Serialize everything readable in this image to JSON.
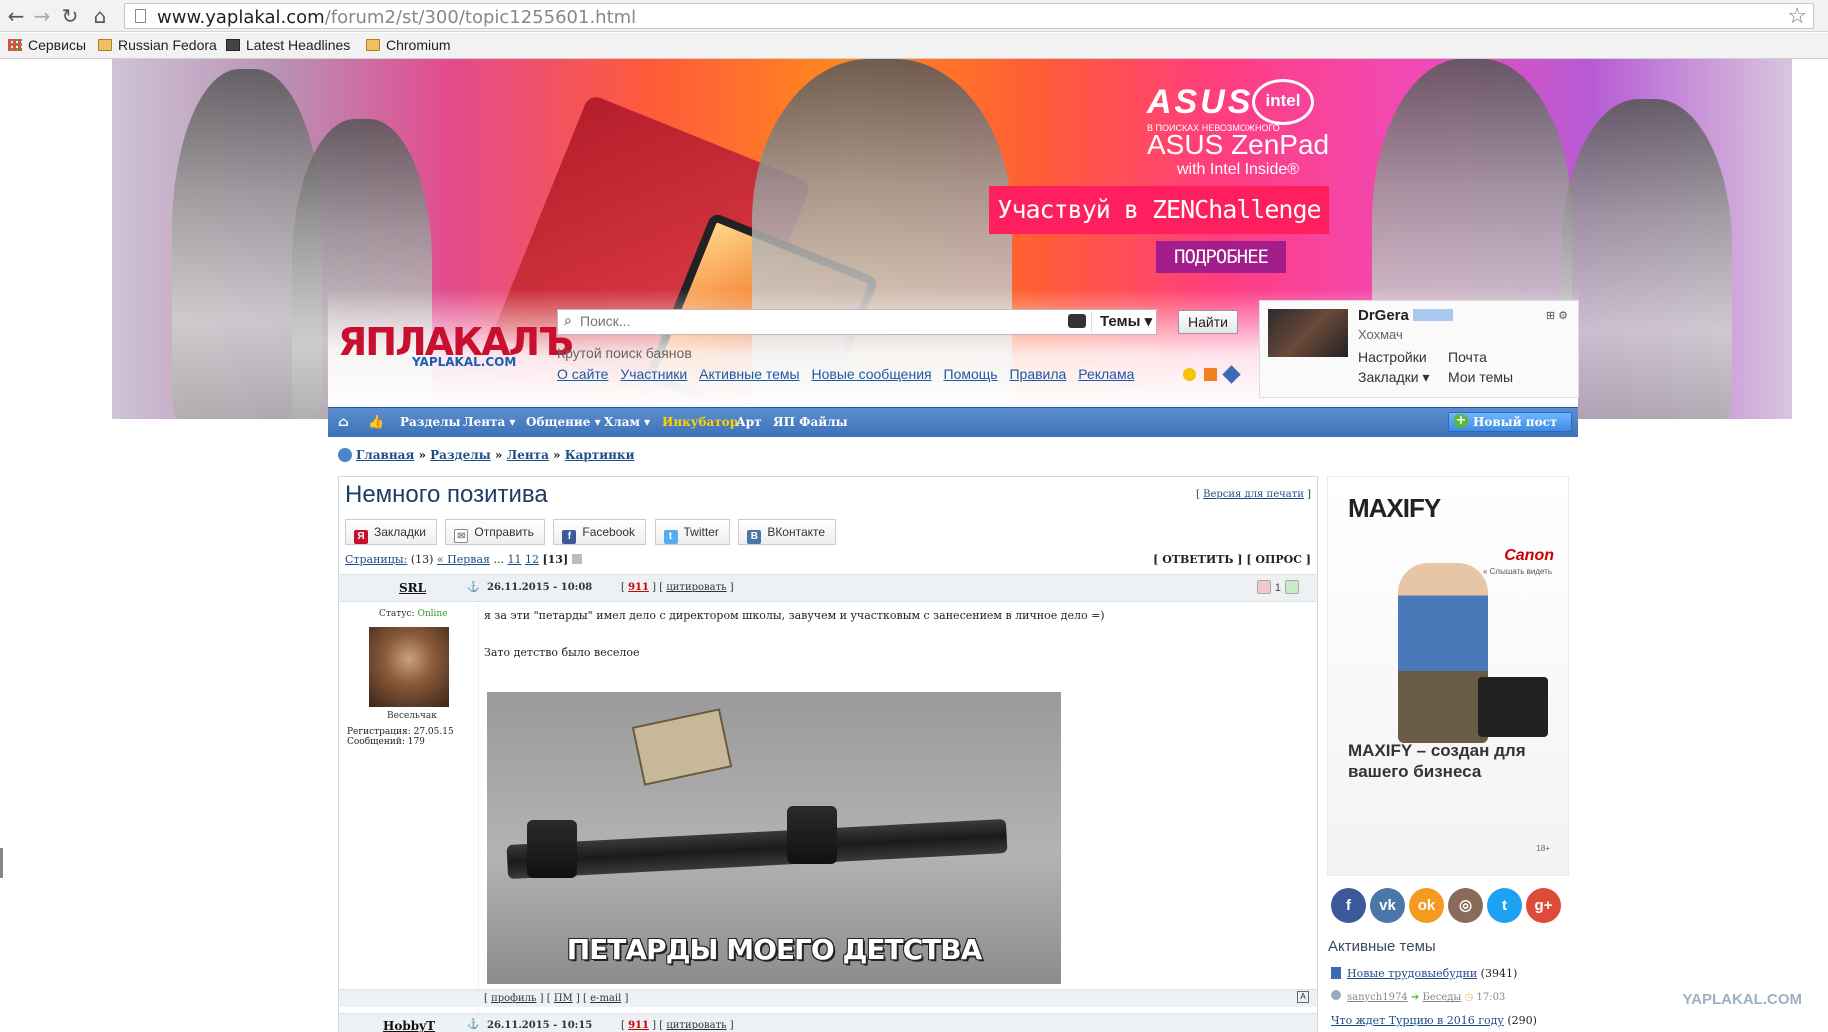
{
  "browser": {
    "url_host": "www.yaplakal.com",
    "url_path": "/forum2/st/300/topic1255601.html",
    "bookmarks": [
      "Сервисы",
      "Russian Fedora",
      "Latest Headlines",
      "Chromium"
    ]
  },
  "banner": {
    "brand": "ASUS",
    "brand_sub": "В ПОИСКАХ НЕВОЗМОЖНОГО",
    "partner": "intel",
    "partner_sub": "inside",
    "product": "ASUS ZenPad",
    "product_sub": "with Intel Inside®",
    "cta": "Участвуй в ZENChallenge",
    "more": "ПОДРОБНЕЕ"
  },
  "site": {
    "logo": "ЯПЛАКАЛЪ",
    "logo_sub": "YAPLAKAL.COM",
    "search_placeholder": "Поиск...",
    "search_scope": "Темы",
    "search_button": "Найти",
    "search_hint": "Крутой поиск баянов",
    "top_links": [
      "О сайте",
      "Участники",
      "Активные темы",
      "Новые сообщения",
      "Помощь",
      "Правила",
      "Реклама"
    ]
  },
  "user": {
    "name": "DrGera",
    "status": "Хохмач",
    "settings": "Настройки",
    "mail": "Почта",
    "bookmarks": "Закладки",
    "my_topics": "Мои темы"
  },
  "nav": {
    "items": [
      "Разделы",
      "Лента",
      "Общение",
      "Хлам",
      "Инкубатор",
      "Арт",
      "ЯП Файлы"
    ],
    "new_post": "Новый пост"
  },
  "breadcrumb": [
    "Главная",
    "Разделы",
    "Лента",
    "Картинки"
  ],
  "thread": {
    "title": "Немного позитива",
    "print_link": "Версия для печати",
    "share": [
      "Закладки",
      "Отправить",
      "Facebook",
      "Twitter",
      "ВКонтакте"
    ],
    "pages_label": "Страницы:",
    "pages_count": "(13)",
    "first": "« Первая",
    "page_a": "11",
    "page_b": "12",
    "page_current": "[13]",
    "reply": "[ ОТВЕТИТЬ ] [ ОПРОС ]"
  },
  "post": {
    "author": "SRL",
    "date": "26.11.2015 - 10:08",
    "number": "911",
    "quote": "цитировать",
    "rating": "1",
    "status_label": "Статус:",
    "status_value": "Online",
    "rank": "Весельчак",
    "registered": "Регистрация: 27.05.15",
    "messages": "Сообщений: 179",
    "text1": "я за эти \"петарды\" имел дело с директором школы, завучем и участковым с занесением в личное дело =)",
    "text2": "Зато детство было веселое",
    "image_caption": "ПЕТАРДЫ МОЕГО ДЕТСТВА",
    "footer_links": [
      "профиль",
      "ПМ",
      "e-mail"
    ]
  },
  "post2": {
    "author": "HobbyT",
    "date": "26.11.2015 - 10:15",
    "number": "911",
    "quote": "цитировать"
  },
  "ad": {
    "brand": "MAXIFY",
    "partner": "Canon",
    "partner_sub": "« Слышать видеть",
    "text": "MAXIFY – создан для вашего бизнеса",
    "age": "18+"
  },
  "socials": [
    "f",
    "vk",
    "ok",
    "ig",
    "tw",
    "g+"
  ],
  "active_topics": {
    "title": "Активные темы",
    "item1": "Новые трудовыебудни",
    "item1_count": "(3941)",
    "item1_user": "sanych1974",
    "item1_section": "Беседы",
    "item1_time": "17:03",
    "item2": "Что ждет Турцию в 2016 году",
    "item2_count": "(290)"
  },
  "watermark": "YAPLAKAL.COM"
}
